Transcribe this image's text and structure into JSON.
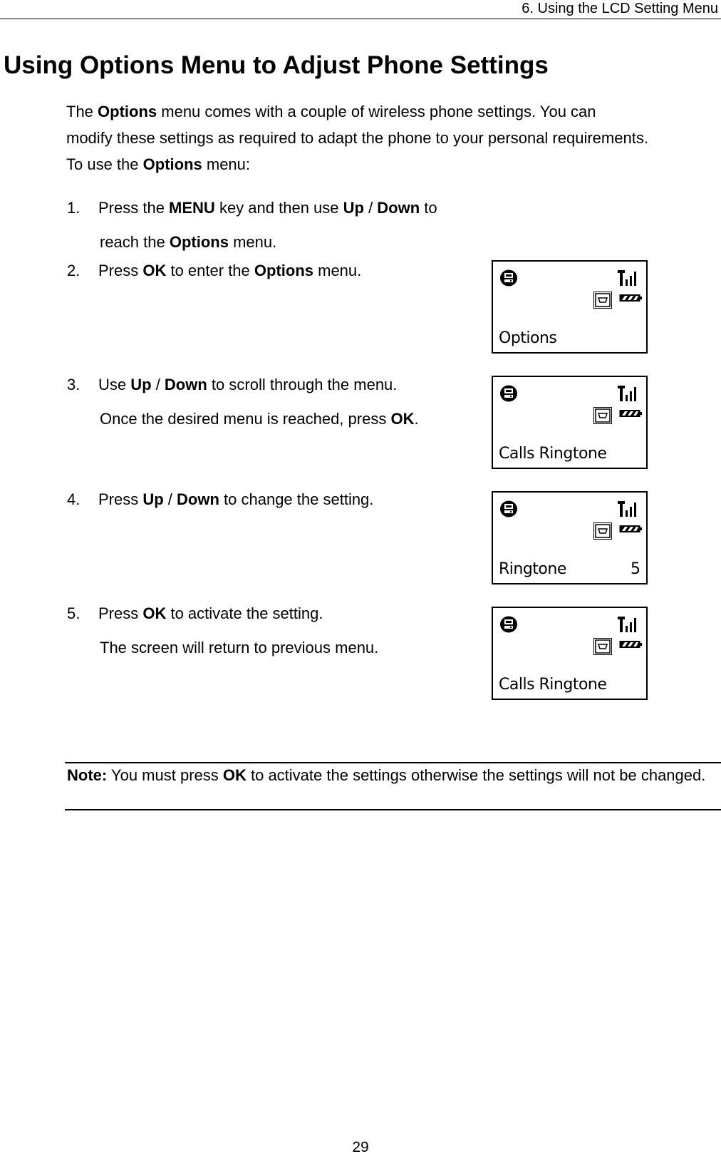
{
  "header": {
    "running_title": "6. Using the LCD Setting Menu"
  },
  "page_title": "Using Options Menu to Adjust Phone Settings",
  "intro": {
    "line1": {
      "pre": "The ",
      "bold": "Options",
      "post": " menu comes with a couple of wireless phone settings. You can"
    },
    "line2": "modify these settings as required to adapt the phone to your personal requirements.",
    "line3": {
      "pre": "To use the ",
      "bold": "Options",
      "post": " menu:"
    }
  },
  "steps": [
    {
      "number": "1.",
      "line1": [
        {
          "t": "Press the ",
          "b": false
        },
        {
          "t": "MENU",
          "b": true
        },
        {
          "t": " key and then use ",
          "b": false
        },
        {
          "t": "Up",
          "b": true
        },
        {
          "t": " / ",
          "b": false
        },
        {
          "t": "Down",
          "b": true
        },
        {
          "t": " to",
          "b": false
        }
      ],
      "line2": [
        {
          "t": "reach the ",
          "b": false
        },
        {
          "t": "Options",
          "b": true
        },
        {
          "t": " menu.",
          "b": false
        }
      ]
    },
    {
      "number": "2.",
      "line1": [
        {
          "t": "Press ",
          "b": false
        },
        {
          "t": "OK",
          "b": true
        },
        {
          "t": " to enter the ",
          "b": false
        },
        {
          "t": "Options",
          "b": true
        },
        {
          "t": " menu.",
          "b": false
        }
      ],
      "line2": []
    },
    {
      "number": "3.",
      "line1": [
        {
          "t": "Use ",
          "b": false
        },
        {
          "t": "Up",
          "b": true
        },
        {
          "t": " / ",
          "b": false
        },
        {
          "t": "Down",
          "b": true
        },
        {
          "t": " to scroll through the menu.",
          "b": false
        }
      ],
      "line2": [
        {
          "t": "Once the desired menu is reached, press ",
          "b": false
        },
        {
          "t": "OK",
          "b": true
        },
        {
          "t": ".",
          "b": false
        }
      ]
    },
    {
      "number": "4.",
      "line1": [
        {
          "t": "Press ",
          "b": false
        },
        {
          "t": "Up",
          "b": true
        },
        {
          "t": " / ",
          "b": false
        },
        {
          "t": "Down",
          "b": true
        },
        {
          "t": " to change the setting.",
          "b": false
        }
      ],
      "line2": []
    },
    {
      "number": "5.",
      "line1": [
        {
          "t": "Press ",
          "b": false
        },
        {
          "t": "OK",
          "b": true
        },
        {
          "t": " to activate the setting.",
          "b": false
        }
      ],
      "line2": [
        {
          "t": "The screen will return to previous menu.",
          "b": false
        }
      ]
    }
  ],
  "lcd_screens": [
    {
      "text": "Options",
      "value": ""
    },
    {
      "text": "Calls Ringtone",
      "value": ""
    },
    {
      "text": "Ringtone",
      "value": "5"
    },
    {
      "text": "Calls Ringtone",
      "value": ""
    }
  ],
  "lcd_icons": [
    "handset-icon",
    "signal-strength-icon",
    "message-icon",
    "battery-icon"
  ],
  "note": {
    "label": "Note:",
    "pre": " You must press ",
    "bold": "OK",
    "post": " to activate the settings otherwise the settings will not be changed."
  },
  "page_number": "29"
}
